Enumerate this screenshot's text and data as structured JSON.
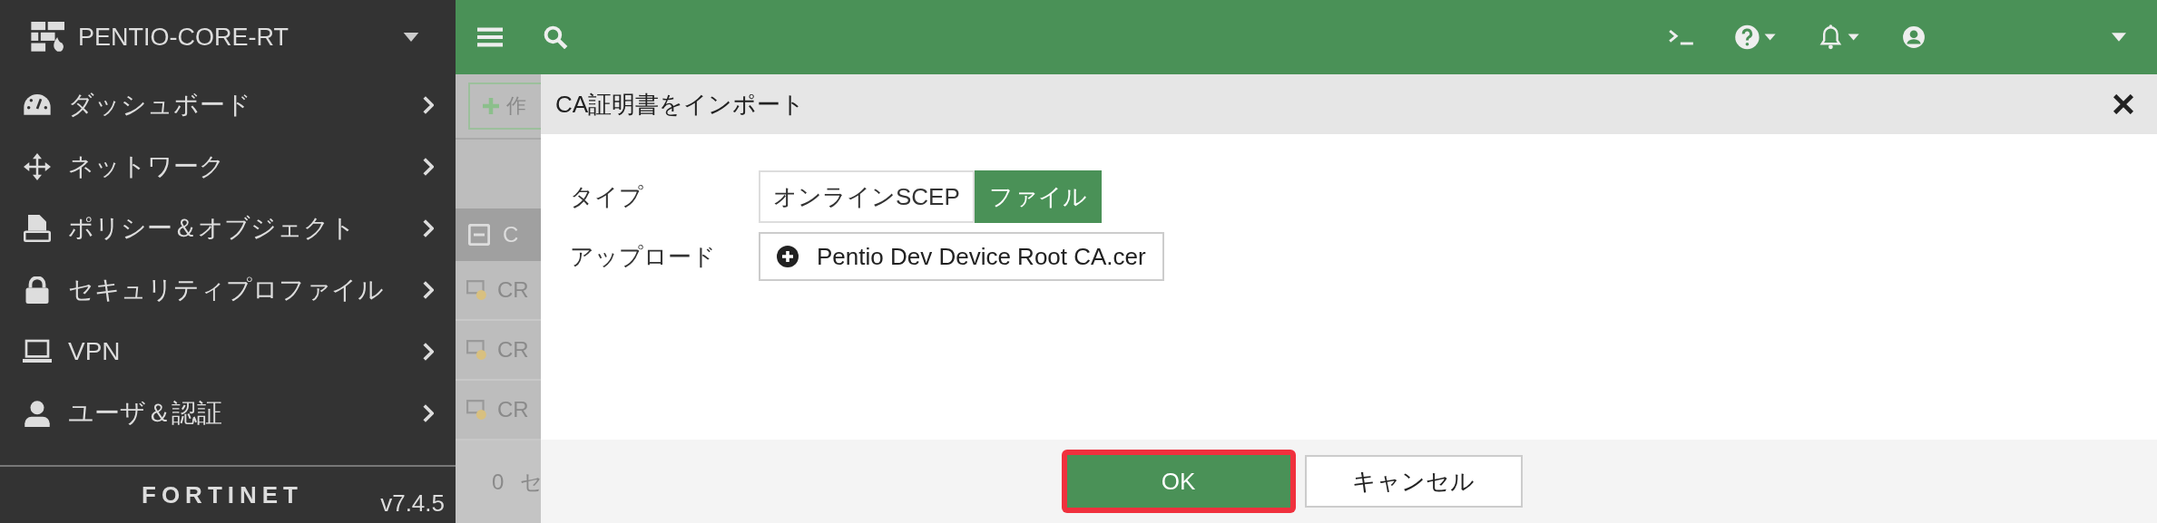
{
  "sidebar": {
    "device": {
      "name": "PENTIO-CORE-RT"
    },
    "items": [
      {
        "label": "ダッシュボード"
      },
      {
        "label": "ネットワーク"
      },
      {
        "label": "ポリシー＆オブジェクト"
      },
      {
        "label": "セキュリティプロファイル"
      },
      {
        "label": "VPN"
      },
      {
        "label": "ユーザ＆認証"
      }
    ],
    "footer": {
      "logo": "FORTINET",
      "version": "v7.4.5"
    }
  },
  "background": {
    "create_button": "作",
    "header_row": "C",
    "rows": [
      "CR",
      "CR",
      "CR"
    ],
    "footer_count": "0",
    "footer_text": "セ"
  },
  "dialog": {
    "title": "CA証明書をインポート",
    "fields": [
      {
        "kind": "segmented",
        "label": "タイプ",
        "options": [
          {
            "label": "オンラインSCEP",
            "selected": false
          },
          {
            "label": "ファイル",
            "selected": true
          }
        ]
      },
      {
        "kind": "upload",
        "label": "アップロード",
        "value": "Pentio Dev Device Root CA.cer"
      }
    ],
    "buttons": [
      {
        "label": "OK",
        "primary": true,
        "highlighted": true
      },
      {
        "label": "キャンセル",
        "primary": false,
        "highlighted": false
      }
    ]
  }
}
